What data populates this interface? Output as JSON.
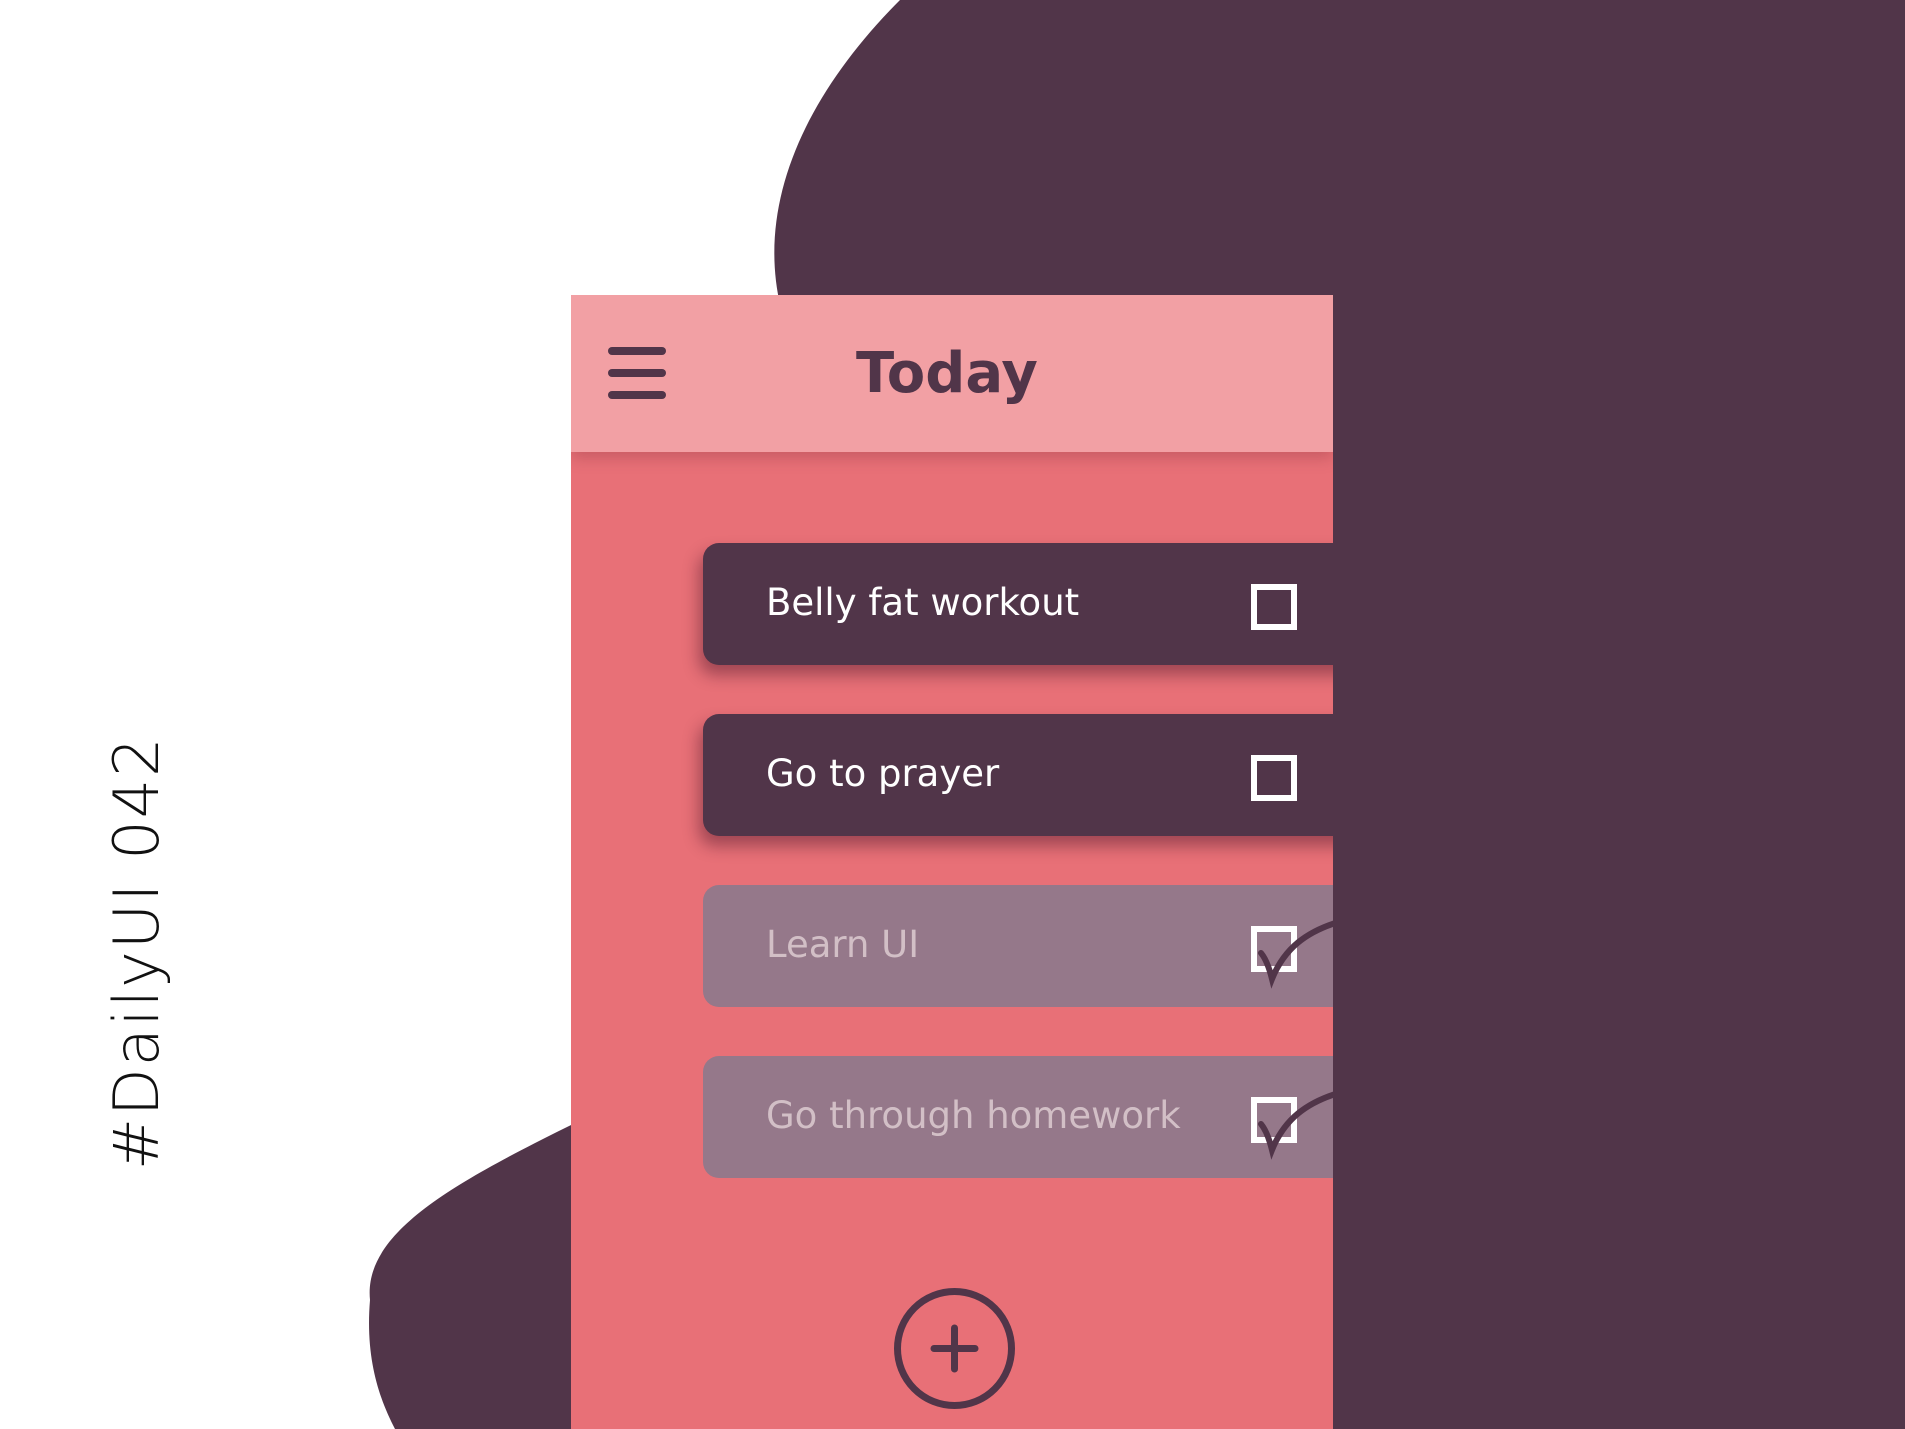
{
  "side_label": "#DailyUI 042",
  "header": {
    "title": "Today",
    "menu_icon": "hamburger-menu-icon"
  },
  "tasks": [
    {
      "label": "Belly fat workout",
      "completed": false
    },
    {
      "label": "Go to prayer",
      "completed": false
    },
    {
      "label": "Learn UI",
      "completed": true
    },
    {
      "label": "Go through homework",
      "completed": true
    }
  ],
  "add_button": {
    "icon": "plus-icon"
  },
  "colors": {
    "background": "#ffffff",
    "plum": "#513549",
    "header_pink": "#f2a0a4",
    "body_coral": "#e87077",
    "done_mauve": "#95788a",
    "done_text": "#d2bfc6"
  }
}
